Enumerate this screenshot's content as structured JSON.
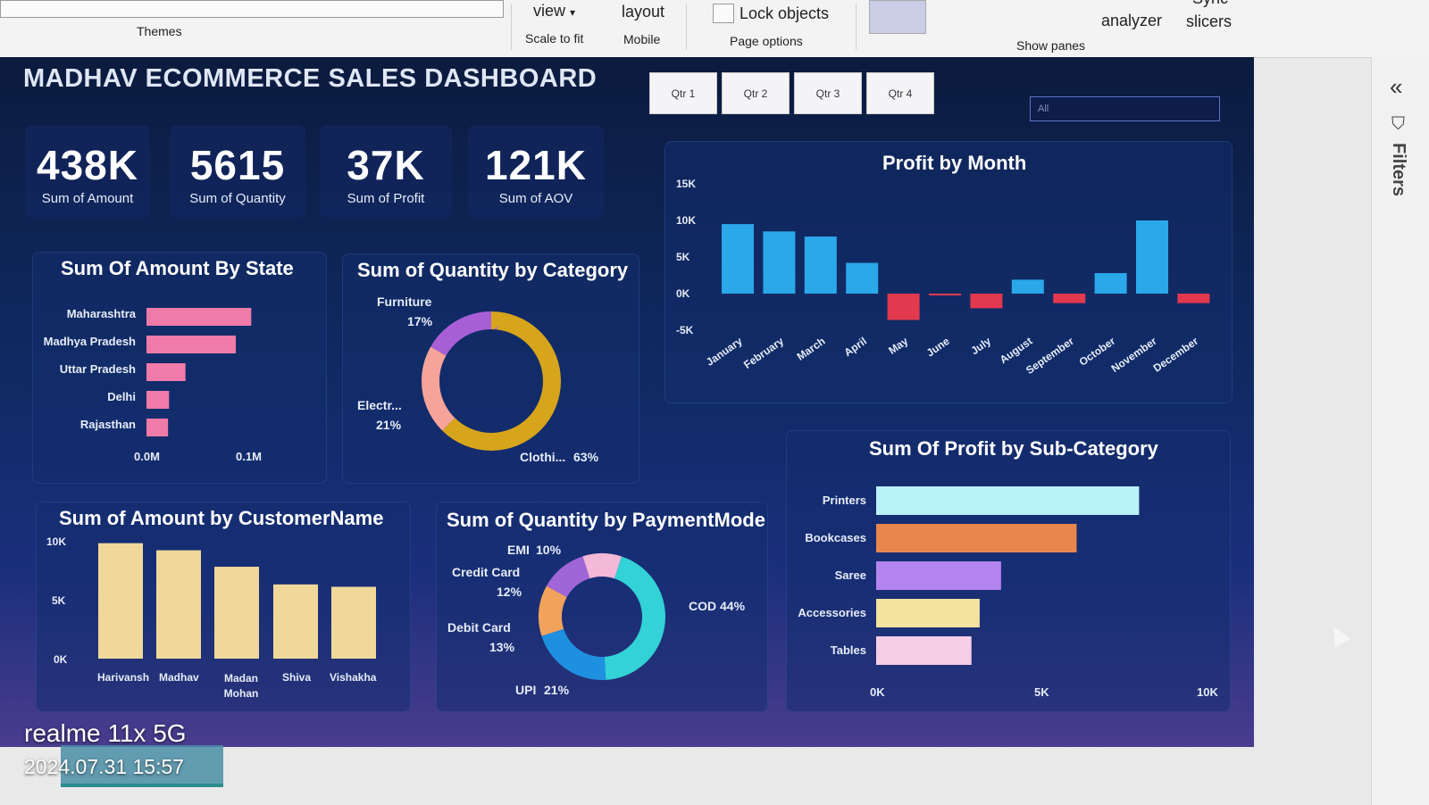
{
  "ribbon": {
    "themes": "Themes",
    "view": "view",
    "scale_to_fit": "Scale to fit",
    "layout": "layout",
    "mobile": "Mobile",
    "lock_objects": "Lock objects",
    "page_options": "Page options",
    "analyzer": "analyzer",
    "sync": "Sync",
    "slicers": "slicers",
    "show_panes": "Show panes"
  },
  "dashboard": {
    "title": "MADHAV ECOMMERCE SALES DASHBOARD",
    "quarters": [
      "Qtr 1",
      "Qtr 2",
      "Qtr 3",
      "Qtr 4"
    ],
    "slicer_value": "All",
    "kpis": [
      {
        "value": "438K",
        "label": "Sum of Amount"
      },
      {
        "value": "5615",
        "label": "Sum of Quantity"
      },
      {
        "value": "37K",
        "label": "Sum of Profit"
      },
      {
        "value": "121K",
        "label": "Sum of AOV"
      }
    ]
  },
  "filters_pane": {
    "label": "Filters"
  },
  "watermark": {
    "device": "realme 11x 5G",
    "timestamp": "2024.07.31 15:57"
  },
  "chart_data": [
    {
      "type": "bar",
      "orientation": "horizontal",
      "title": "Sum Of Amount By State",
      "categories": [
        "Maharashtra",
        "Madhya Pradesh",
        "Uttar Pradesh",
        "Delhi",
        "Rajasthan"
      ],
      "values": [
        0.102,
        0.087,
        0.038,
        0.022,
        0.021
      ],
      "xticks": [
        "0.0M",
        "0.1M"
      ],
      "xlim": [
        0,
        0.1
      ],
      "color": "#f07aa8"
    },
    {
      "type": "pie",
      "title": "Sum of Quantity by Category",
      "donut": true,
      "slices": [
        {
          "label": "Clothi...",
          "pct": "63%",
          "value": 63,
          "color": "#d6a51c"
        },
        {
          "label": "Electr...",
          "pct": "21%",
          "value": 21,
          "color": "#f6a39a"
        },
        {
          "label": "Furniture",
          "pct": "17%",
          "value": 17,
          "color": "#a85fd6"
        }
      ]
    },
    {
      "type": "bar",
      "title": "Profit by Month",
      "categories": [
        "January",
        "February",
        "March",
        "April",
        "May",
        "June",
        "July",
        "August",
        "September",
        "October",
        "November",
        "December"
      ],
      "values": [
        9500,
        8500,
        7800,
        4200,
        -3600,
        -200,
        -2000,
        1900,
        -1300,
        2800,
        10000,
        -1300
      ],
      "yticks": [
        "15K",
        "10K",
        "5K",
        "0K",
        "-5K"
      ],
      "ylim": [
        -5000,
        15000
      ],
      "positive_color": "#2aa8ea",
      "negative_color": "#e2394f"
    },
    {
      "type": "bar",
      "orientation": "horizontal",
      "title": "Sum Of Profit by Sub-Category",
      "categories": [
        "Printers",
        "Bookcases",
        "Saree",
        "Accessories",
        "Tables"
      ],
      "values": [
        8000,
        6100,
        3800,
        3150,
        2900
      ],
      "xticks": [
        "0K",
        "5K",
        "10K"
      ],
      "xlim": [
        0,
        10000
      ],
      "colors": [
        "#b9f1f8",
        "#e9864e",
        "#b485ef",
        "#f3e2a0",
        "#f4cde6"
      ]
    },
    {
      "type": "bar",
      "title": "Sum of Amount by CustomerName",
      "categories": [
        "Harivansh",
        "Madhav",
        "Madan Mohan",
        "Shiva",
        "Vishakha"
      ],
      "values": [
        9800,
        9200,
        7800,
        6300,
        6100
      ],
      "yticks": [
        "10K",
        "5K",
        "0K"
      ],
      "ylim": [
        0,
        10000
      ],
      "color": "#f0d89a"
    },
    {
      "type": "pie",
      "title": "Sum of Quantity by PaymentMode",
      "donut": true,
      "slices": [
        {
          "label": "COD",
          "pct": "44%",
          "value": 44,
          "color": "#32d2d6"
        },
        {
          "label": "UPI",
          "pct": "21%",
          "value": 21,
          "color": "#1f8fe0"
        },
        {
          "label": "Debit Card",
          "pct": "13%",
          "value": 13,
          "color": "#f1a35c"
        },
        {
          "label": "Credit Card",
          "pct": "12%",
          "value": 12,
          "color": "#a066d8"
        },
        {
          "label": "EMI",
          "pct": "10%",
          "value": 10,
          "color": "#f4b8d8"
        }
      ]
    }
  ]
}
